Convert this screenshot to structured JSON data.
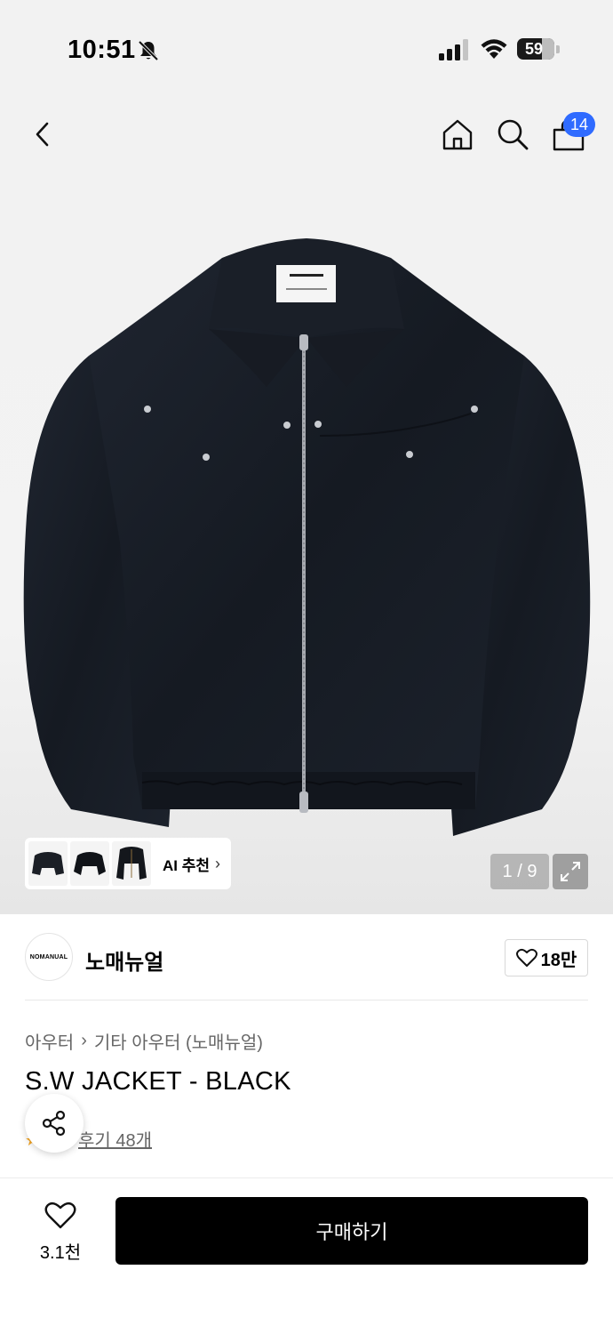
{
  "status_bar": {
    "time": "10:51",
    "battery": "59"
  },
  "nav": {
    "cart_count": "14"
  },
  "gallery": {
    "counter": "1 / 9",
    "ai_label": "AI 추천",
    "ai_chevron": "›"
  },
  "brand": {
    "logo_text": "NOMANUAL",
    "name": "노매뉴얼",
    "likes": "18만"
  },
  "breadcrumb": {
    "level1": "아우터",
    "separator": "›",
    "level2": "기타 아우터 (노매뉴얼)"
  },
  "product": {
    "title": "S.W JACKET - BLACK",
    "review_label": "후기 48개"
  },
  "bottom_bar": {
    "like_count": "3.1천",
    "buy_label": "구매하기"
  },
  "icons": [
    "bell-off-icon",
    "signal-icon",
    "wifi-icon",
    "battery-icon",
    "back-icon",
    "home-icon",
    "search-icon",
    "cart-icon",
    "expand-icon",
    "heart-icon",
    "share-icon",
    "star-icon"
  ],
  "colors": {
    "badge_blue": "#2f6bff",
    "buy_button": "#000000",
    "jacket": "#1b1f26"
  }
}
